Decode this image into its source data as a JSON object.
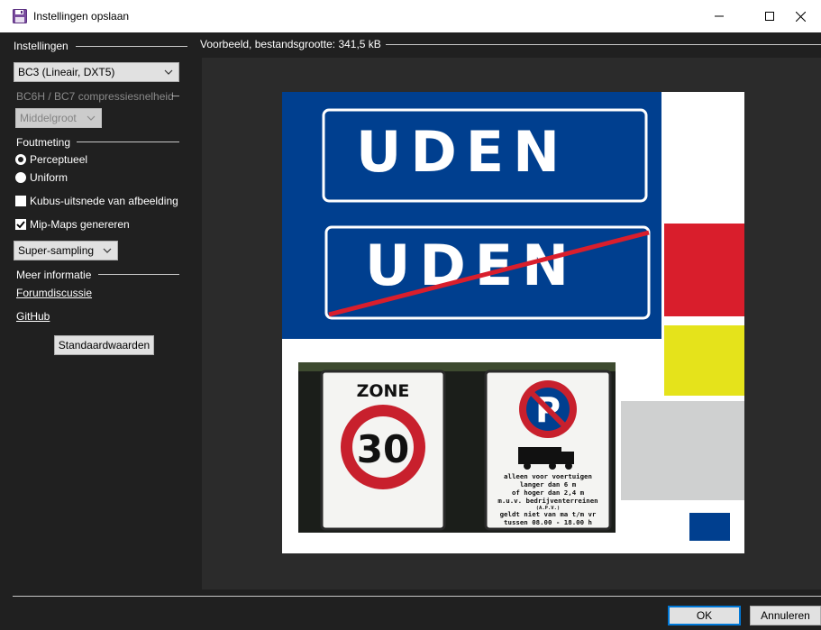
{
  "window": {
    "title": "Instellingen opslaan",
    "icon": "floppy-disk-icon",
    "controls": {
      "minimize": "minimize-icon",
      "maximize": "maximize-icon",
      "close": "close-icon"
    }
  },
  "settings": {
    "heading": "Instellingen",
    "format_select": "BC3 (Lineair, DXT5)",
    "compression_label": "BC6H / BC7 compressiesnelheid",
    "compression_select": "Middelgroot",
    "error_heading": "Foutmeting",
    "error_options": [
      {
        "label": "Perceptueel",
        "selected": true
      },
      {
        "label": "Uniform",
        "selected": false
      }
    ],
    "cube_checkbox": {
      "label": "Kubus-uitsnede van afbeelding",
      "checked": false
    },
    "mipmaps_checkbox": {
      "label": "Mip-Maps genereren",
      "checked": true
    },
    "mip_filter_select": "Super-sampling",
    "info_heading": "Meer informatie",
    "forum_link": "Forumdiscussie",
    "github_link": "GitHub",
    "defaults_button": "Standaardwaarden"
  },
  "preview": {
    "heading": "Voorbeeld, bestandsgrootte: 341,5 kB",
    "sign_top_text": "UDEN",
    "sign_bottom_text": "UDEN",
    "zone_sign": {
      "title": "ZONE",
      "number": "30"
    },
    "parking_sign": {
      "letter": "P",
      "lines": [
        "alleen voor voertuigen",
        "langer dan 6 m",
        "of hoger dan 2,4 m",
        "m.u.v. bedrijventerreinen",
        "(A.P.V.)",
        "geldt niet van ma t/m vr",
        "tussen 08.00 - 18.00 h"
      ]
    },
    "colors": {
      "sign_blue": "#003f8f",
      "red": "#d91e2c",
      "yellow": "#e5e31b",
      "grey": "#cfd0d0"
    }
  },
  "footer": {
    "ok_button": "OK",
    "cancel_button": "Annuleren"
  }
}
